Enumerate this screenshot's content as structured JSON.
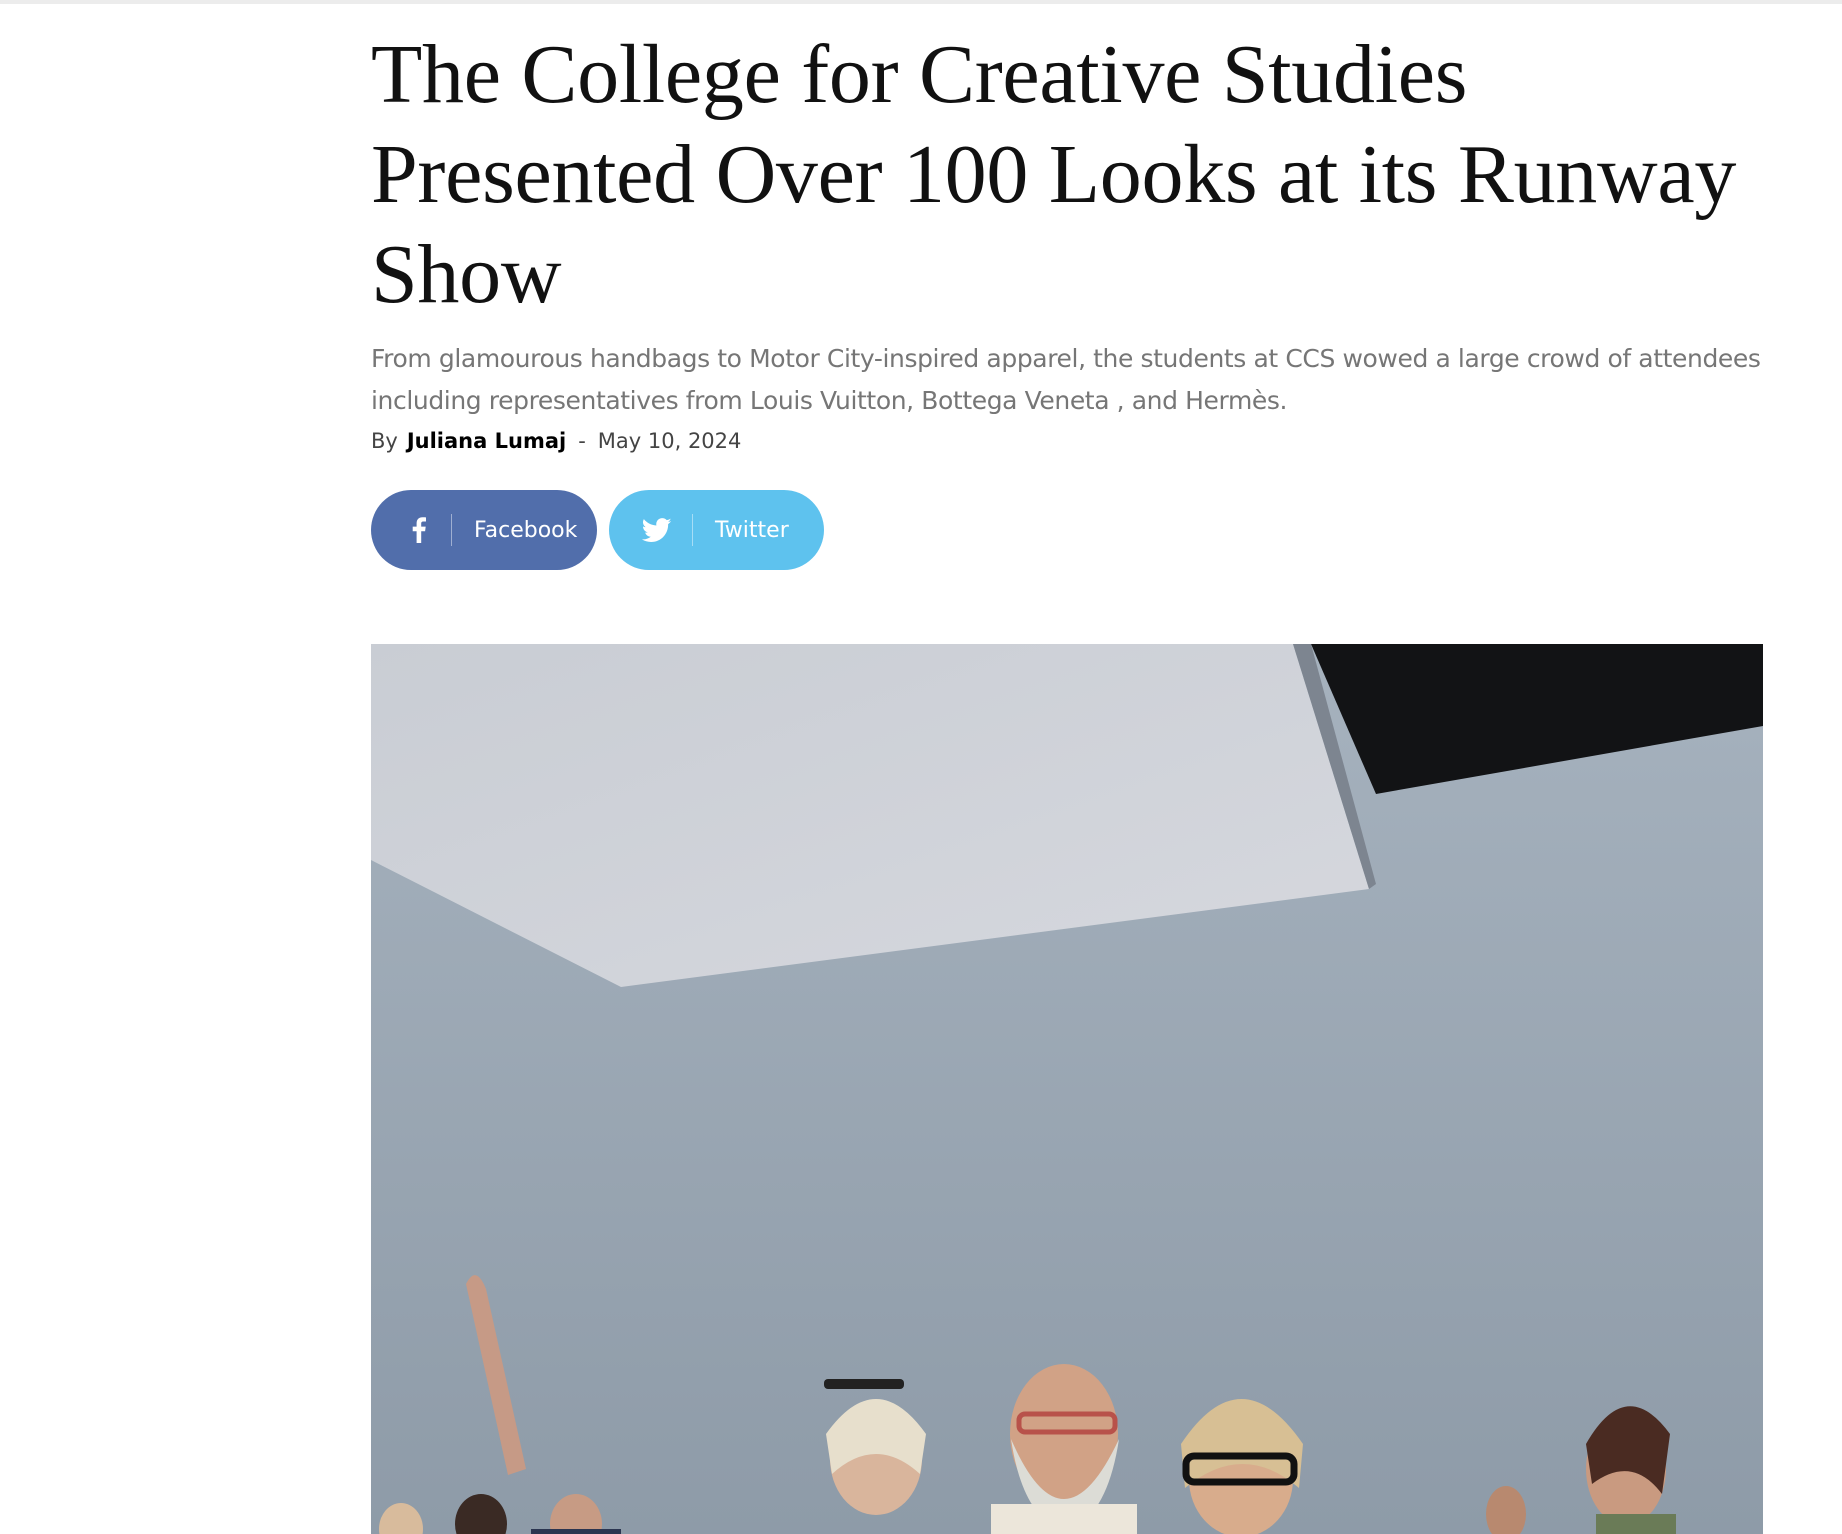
{
  "article": {
    "title": "The College for Creative Studies Presented Over 100 Looks at its Runway Show",
    "subtitle": "From glamourous handbags to Motor City-inspired apparel, the students at CCS wowed a large crowd of attendees including representatives from Louis Vuitton, Bottega Veneta , and Hermès.",
    "by_label": "By",
    "author": "Juliana Lumaj",
    "separator": "-",
    "date": "May 10, 2024"
  },
  "share": {
    "facebook": {
      "label": "Facebook",
      "icon": "facebook-icon",
      "color": "#516eab"
    },
    "twitter": {
      "label": "Twitter",
      "icon": "twitter-icon",
      "color": "#5ec2ee"
    }
  },
  "featured_image": {
    "subject": "runway-show-attendees-photo"
  }
}
